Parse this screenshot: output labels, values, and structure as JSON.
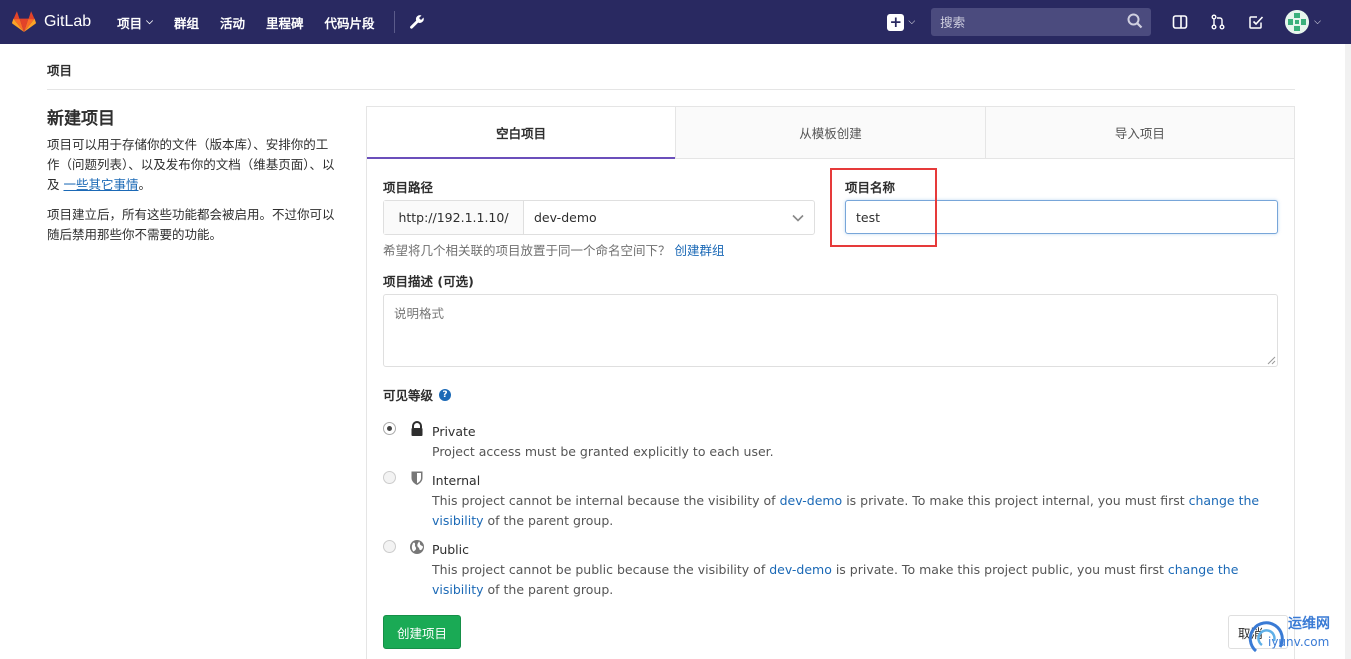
{
  "navbar": {
    "brand": "GitLab",
    "links": [
      {
        "label": "项目",
        "dropdown": true
      },
      {
        "label": "群组",
        "dropdown": false
      },
      {
        "label": "活动",
        "dropdown": false
      },
      {
        "label": "里程碑",
        "dropdown": false
      },
      {
        "label": "代码片段",
        "dropdown": false
      }
    ],
    "search_placeholder": "搜索",
    "bg_color": "#292961"
  },
  "breadcrumb": "项目",
  "sidebar": {
    "title": "新建项目",
    "para1_text": "项目可以用于存储你的文件（版本库）、安排你的工作（问题列表）、以及发布你的文档（维基页面）、以及 ",
    "para1_link": "一些其它事情",
    "para1_end": "。",
    "para2": "项目建立后，所有这些功能都会被启用。不过你可以随后禁用那些你不需要的功能。"
  },
  "tabs": [
    {
      "label": "空白项目",
      "active": true
    },
    {
      "label": "从模板创建",
      "active": false
    },
    {
      "label": "导入项目",
      "active": false
    }
  ],
  "form": {
    "path_label": "项目路径",
    "path_prefix": "http://192.1.1.10/",
    "namespace": "dev-demo",
    "hint_text": "希望将几个相关联的项目放置于同一个命名空间下？",
    "hint_link": "创建群组",
    "name_label": "项目名称",
    "name_value": "test",
    "desc_label": "项目描述 (可选)",
    "desc_placeholder": "说明格式",
    "visibility_title": "可见等级",
    "visibility": [
      {
        "name": "Private",
        "checked": true,
        "desc_parts": [
          "Project access must be granted explicitly to each user."
        ]
      },
      {
        "name": "Internal",
        "checked": false,
        "desc_parts": [
          "This project cannot be internal because the visibility of ",
          "dev-demo",
          " is private. To make this project internal, you must first ",
          "change the visibility",
          " of the parent group."
        ]
      },
      {
        "name": "Public",
        "checked": false,
        "desc_parts": [
          "This project cannot be public because the visibility of ",
          "dev-demo",
          " is private. To make this project public, you must first ",
          "change the visibility",
          " of the parent group."
        ]
      }
    ],
    "create_button": "创建项目",
    "cancel_button": "取消"
  },
  "watermark": {
    "line1": "运维网",
    "line2": "iyunv.com"
  },
  "colors": {
    "accent": "#6b4fbb",
    "link": "#1b69b6",
    "success": "#1aaa55",
    "highlight": "#e63a3a"
  }
}
